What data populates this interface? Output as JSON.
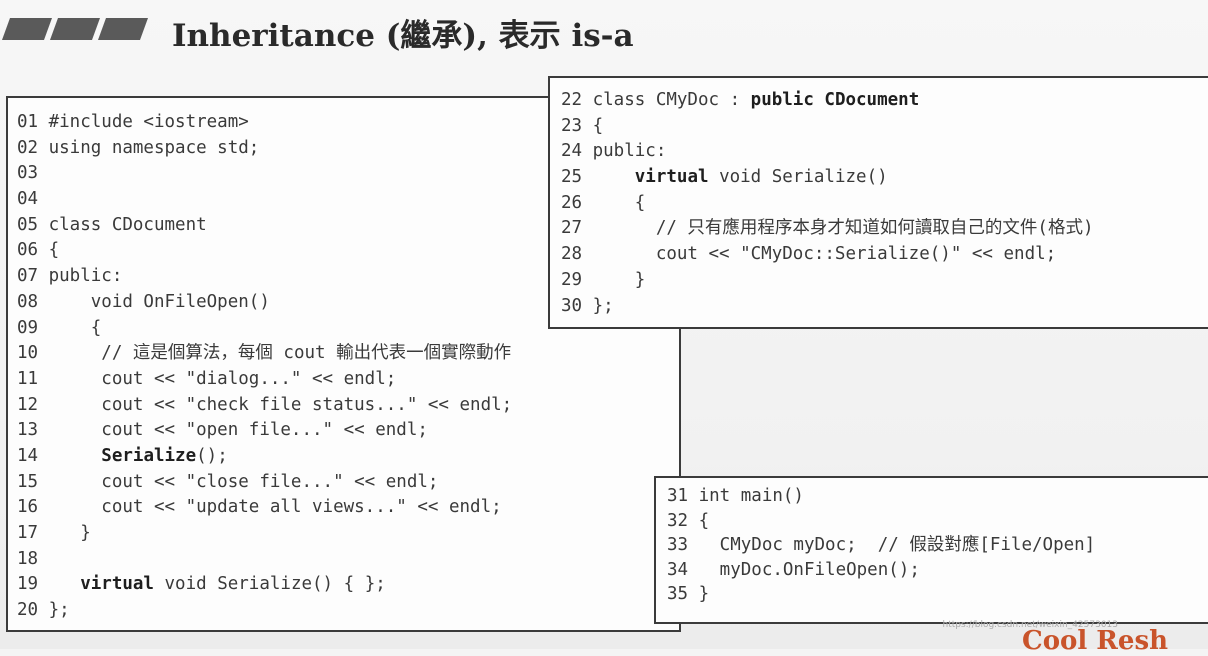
{
  "header": {
    "title": "Inheritance (繼承), 表示 is-a"
  },
  "code_main": [
    {
      "no": "01 ",
      "pre": "#include <iostream>",
      "kw": "",
      "post": ""
    },
    {
      "no": "02 ",
      "pre": "using namespace std;",
      "kw": "",
      "post": ""
    },
    {
      "no": "03 ",
      "pre": "",
      "kw": "",
      "post": ""
    },
    {
      "no": "04 ",
      "pre": "",
      "kw": "",
      "post": ""
    },
    {
      "no": "05 ",
      "pre": "class CDocument",
      "kw": "",
      "post": ""
    },
    {
      "no": "06 ",
      "pre": "{",
      "kw": "",
      "post": ""
    },
    {
      "no": "07 ",
      "pre": "public:",
      "kw": "",
      "post": ""
    },
    {
      "no": "08 ",
      "pre": "    void OnFileOpen()",
      "kw": "",
      "post": ""
    },
    {
      "no": "09 ",
      "pre": "    {",
      "kw": "",
      "post": ""
    },
    {
      "no": "10 ",
      "pre": "     // 這是個算法，每個 cout 輸出代表一個實際動作",
      "kw": "",
      "post": ""
    },
    {
      "no": "11 ",
      "pre": "     cout << \"dialog...\" << endl;",
      "kw": "",
      "post": ""
    },
    {
      "no": "12 ",
      "pre": "     cout << \"check file status...\" << endl;",
      "kw": "",
      "post": ""
    },
    {
      "no": "13 ",
      "pre": "     cout << \"open file...\" << endl;",
      "kw": "",
      "post": ""
    },
    {
      "no": "14 ",
      "pre": "     ",
      "kw": "Serialize",
      "post": "();"
    },
    {
      "no": "15 ",
      "pre": "     cout << \"close file...\" << endl;",
      "kw": "",
      "post": ""
    },
    {
      "no": "16 ",
      "pre": "     cout << \"update all views...\" << endl;",
      "kw": "",
      "post": ""
    },
    {
      "no": "17 ",
      "pre": "   }",
      "kw": "",
      "post": ""
    },
    {
      "no": "18 ",
      "pre": "",
      "kw": "",
      "post": ""
    },
    {
      "no": "19 ",
      "pre": "   ",
      "kw": "virtual",
      "post": " void Serialize() { };"
    },
    {
      "no": "20 ",
      "pre": "};",
      "kw": "",
      "post": ""
    }
  ],
  "code_derived": [
    {
      "no": "22 ",
      "pre": "class CMyDoc : ",
      "kw": "public CDocument",
      "post": ""
    },
    {
      "no": "23 ",
      "pre": "{",
      "kw": "",
      "post": ""
    },
    {
      "no": "24 ",
      "pre": "public:",
      "kw": "",
      "post": ""
    },
    {
      "no": "25 ",
      "pre": "    ",
      "kw": "virtual",
      "post": " void Serialize()"
    },
    {
      "no": "26 ",
      "pre": "    {",
      "kw": "",
      "post": ""
    },
    {
      "no": "27 ",
      "pre": "      // 只有應用程序本身才知道如何讀取自己的文件(格式)",
      "kw": "",
      "post": ""
    },
    {
      "no": "28 ",
      "pre": "      cout << \"CMyDoc::Serialize()\" << endl;",
      "kw": "",
      "post": ""
    },
    {
      "no": "29 ",
      "pre": "    }",
      "kw": "",
      "post": ""
    },
    {
      "no": "30 ",
      "pre": "};",
      "kw": "",
      "post": ""
    }
  ],
  "code_entry": [
    {
      "no": "31 ",
      "pre": "int main()",
      "kw": "",
      "post": ""
    },
    {
      "no": "32 ",
      "pre": "{",
      "kw": "",
      "post": ""
    },
    {
      "no": "33 ",
      "pre": "  CMyDoc myDoc;  // 假設對應[File/Open]",
      "kw": "",
      "post": ""
    },
    {
      "no": "34 ",
      "pre": "  myDoc.OnFileOpen();",
      "kw": "",
      "post": ""
    },
    {
      "no": "35 ",
      "pre": "}",
      "kw": "",
      "post": ""
    }
  ],
  "watermark": "https://blog.csdn.net/weixin_42573013",
  "brand": "Cool Resh"
}
